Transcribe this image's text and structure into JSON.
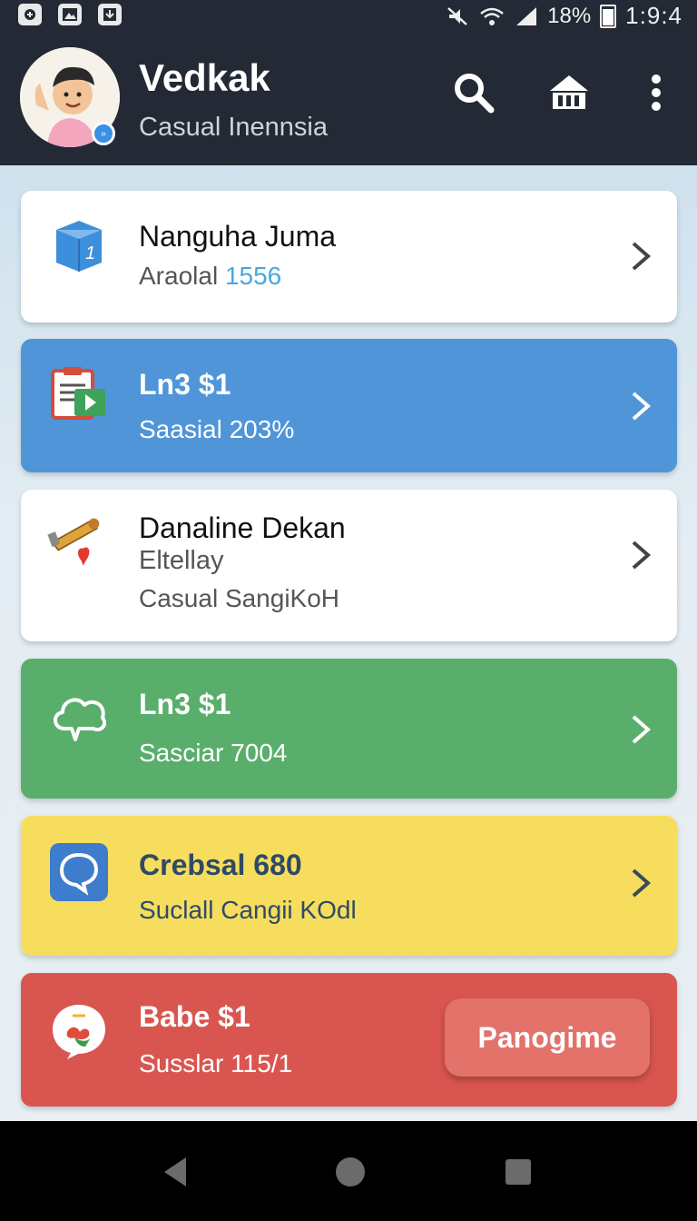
{
  "status_bar": {
    "battery": "18%",
    "time": "1:9:4"
  },
  "header": {
    "title": "Vedkak",
    "subtitle": "Casual Inennsia"
  },
  "toolbar_icons": [
    "search-icon",
    "store-icon",
    "more-vert-icon"
  ],
  "cards": [
    {
      "title": "Nanguha Juma",
      "sub_prefix": "Araolal",
      "sub_value": "1556",
      "color": "#ffffff",
      "icon": "cube-icon"
    },
    {
      "title": "Ln3 $1",
      "sub": "Saasial 203%",
      "color": "#4f95d8",
      "icon": "clipboard-play-icon"
    },
    {
      "title": "Danaline Dekan",
      "line2": "Eltellay",
      "line3": "Casual SangiKoH",
      "color": "#ffffff",
      "icon": "hammer-heart-icon"
    },
    {
      "title": "Ln3 $1",
      "sub": "Sasciar 7004",
      "color": "#5aae6c",
      "icon": "cloud-icon"
    },
    {
      "title": "Crebsal 680",
      "sub": "Suclall Cangii KOdl",
      "color": "#f6dd5e",
      "icon": "chat-bubble-icon"
    },
    {
      "title": "Babe $1",
      "sub": "Susslar 115/1",
      "color": "#d95650",
      "icon": "candy-bubble-icon",
      "button_label": "Panogime"
    }
  ],
  "nav": [
    "back-icon",
    "home-icon",
    "recents-icon"
  ]
}
